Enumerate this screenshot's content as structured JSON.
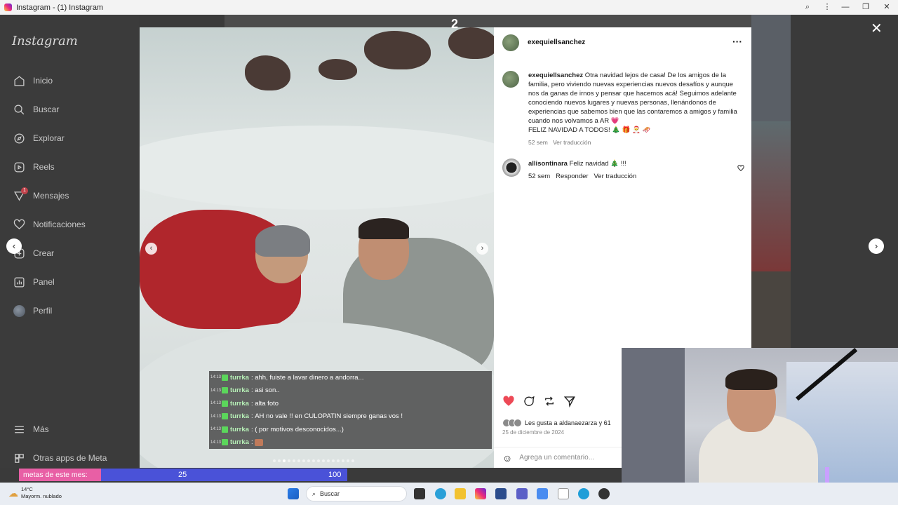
{
  "window": {
    "title": "Instagram - (1) Instagram"
  },
  "sidebar": {
    "logo": "Instagram",
    "items": [
      {
        "label": "Inicio",
        "icon": "home-icon"
      },
      {
        "label": "Buscar",
        "icon": "search-icon"
      },
      {
        "label": "Explorar",
        "icon": "compass-icon"
      },
      {
        "label": "Reels",
        "icon": "reels-icon"
      },
      {
        "label": "Mensajes",
        "icon": "messenger-icon",
        "badge": "1"
      },
      {
        "label": "Notificaciones",
        "icon": "heart-icon"
      },
      {
        "label": "Crear",
        "icon": "plus-icon"
      },
      {
        "label": "Panel",
        "icon": "dashboard-icon"
      },
      {
        "label": "Perfil",
        "icon": "profile-avatar"
      }
    ],
    "more": "Más",
    "meta_apps": "Otras apps de Meta"
  },
  "post": {
    "slide_number": "2",
    "author": "exequiellsanchez",
    "caption": "Otra navidad lejos de casa! De los amigos de la familia, pero viviendo nuevas experiencias nuevos desafíos y aunque nos da ganas de irnos y pensar que hacemos acá! Seguimos adelante conociendo nuevos lugares y nuevas personas, llenándonos de experiencias que sabemos bien que las contaremos a amigos y familia cuando nos volvamos a AR 💗",
    "caption_line2": "FELIZ NAVIDAD A TODOS! 🎄 🎁 🎅 🛷",
    "caption_time": "52 sem",
    "see_translation": "Ver traducción",
    "comments": [
      {
        "user": "allisontinara",
        "text": "Feliz navidad 🎄 !!!",
        "time": "52 sem",
        "reply": "Responder",
        "translate": "Ver traducción"
      }
    ],
    "likes_text": "Les gusta a aldanaezarza y 61",
    "date": "25 de diciembre de 2024",
    "comment_placeholder": "Agrega un comentario..."
  },
  "chat": {
    "messages": [
      {
        "time": "14:13",
        "user": "turrka",
        "text": "ahh, fuiste a lavar dinero a andorra..."
      },
      {
        "time": "14:13",
        "user": "turrka",
        "text": "asi son.."
      },
      {
        "time": "14:13",
        "user": "turrka",
        "text": "alta foto"
      },
      {
        "time": "14:13",
        "user": "turrka",
        "text": "AH no vale !! en CULOPATIN siempre ganas vos !"
      },
      {
        "time": "14:13",
        "user": "turrka",
        "text": "( por motivos desconocidos...)"
      },
      {
        "time": "14:13",
        "user": "turrka",
        "text": ""
      }
    ]
  },
  "goals": {
    "label": "metas de este mes:",
    "mid_value": "25",
    "max_value": "100"
  },
  "taskbar": {
    "temp": "14°C",
    "weather": "Mayorm. nublado",
    "search": "Buscar"
  },
  "colors": {
    "like_red": "#ed4956",
    "goal_pink": "#e85fa5",
    "goal_blue": "#4a52d8"
  }
}
